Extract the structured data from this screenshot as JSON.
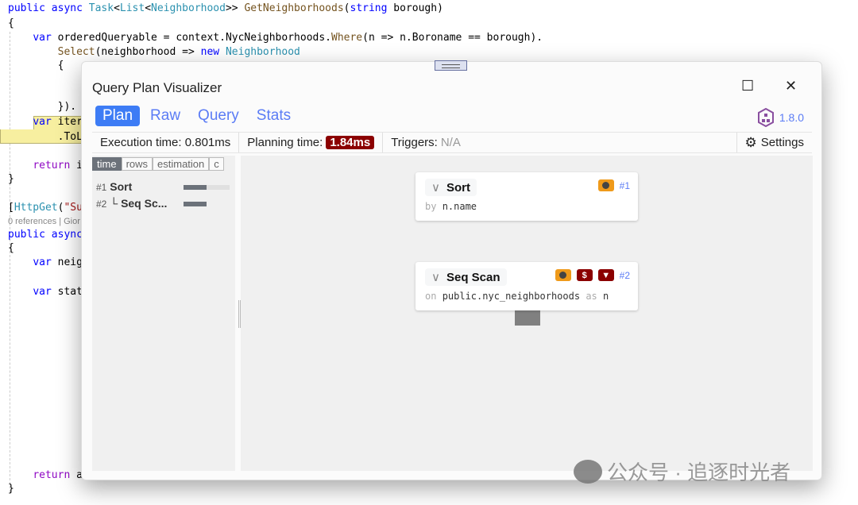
{
  "editor": {
    "lines": [
      {
        "parts": [
          [
            "kw",
            "public async "
          ],
          [
            "ty",
            "Task"
          ],
          [
            "",
            "<"
          ],
          [
            "ty",
            "List"
          ],
          [
            "",
            "<"
          ],
          [
            "ty",
            "Neighborhood"
          ],
          [
            "",
            ">> "
          ],
          [
            "fn",
            "GetNeighborhoods"
          ],
          [
            "",
            "("
          ],
          [
            "kw",
            "string"
          ],
          [
            "",
            " borough)"
          ]
        ]
      },
      {
        "parts": [
          [
            "",
            "{"
          ]
        ]
      },
      {
        "parts": [
          [
            "",
            "    "
          ],
          [
            "kw",
            "var"
          ],
          [
            "",
            " orderedQueryable = context.NycNeighborhoods."
          ],
          [
            "fn",
            "Where"
          ],
          [
            "",
            "(n => n.Boroname == borough)."
          ]
        ]
      },
      {
        "parts": [
          [
            "",
            "        "
          ],
          [
            "fn",
            "Select"
          ],
          [
            "",
            "(neighborhood => "
          ],
          [
            "kw",
            "new"
          ],
          [
            "",
            " "
          ],
          [
            "ty",
            "Neighborhood"
          ]
        ]
      },
      {
        "parts": [
          [
            "",
            "        {"
          ]
        ]
      },
      {
        "parts": [
          [
            "",
            "        })."
          ]
        ]
      },
      {
        "parts": [
          [
            "",
            "    "
          ],
          [
            "kw",
            "var"
          ],
          [
            "",
            " iter"
          ]
        ]
      },
      {
        "parts": [
          [
            "",
            "        .ToL"
          ]
        ]
      },
      {
        "parts": [
          [
            "",
            "    "
          ],
          [
            "ret",
            "return"
          ],
          [
            "",
            " i"
          ]
        ]
      },
      {
        "parts": [
          [
            "",
            "}"
          ]
        ]
      },
      {
        "parts": [
          [
            "",
            "["
          ],
          [
            "ty",
            "HttpGet"
          ],
          [
            "",
            "("
          ],
          [
            "str",
            "\"Su"
          ]
        ]
      },
      {
        "parts": [
          [
            "refs",
            "0 references | Gior"
          ]
        ]
      },
      {
        "parts": [
          [
            "kw",
            "public async"
          ]
        ]
      },
      {
        "parts": [
          [
            "",
            "{"
          ]
        ]
      },
      {
        "parts": [
          [
            "",
            "    "
          ],
          [
            "kw",
            "var"
          ],
          [
            "",
            " neig"
          ]
        ]
      },
      {
        "parts": [
          [
            "",
            "    "
          ],
          [
            "kw",
            "var"
          ],
          [
            "",
            " stat"
          ]
        ]
      },
      {
        "parts": [
          [
            "",
            "    "
          ],
          [
            "ret",
            "return"
          ],
          [
            "",
            " a"
          ]
        ]
      },
      {
        "parts": [
          [
            "",
            "}"
          ]
        ]
      }
    ]
  },
  "window": {
    "title": "Query Plan Visualizer",
    "maximize_icon": "☐",
    "close_icon": "✕"
  },
  "tabs": [
    {
      "label": "Plan",
      "active": true
    },
    {
      "label": "Raw"
    },
    {
      "label": "Query"
    },
    {
      "label": "Stats"
    }
  ],
  "version": "1.8.0",
  "info": {
    "execution_label": "Execution time:",
    "execution_value": "0.801ms",
    "planning_label": "Planning time:",
    "planning_value": "1.84ms",
    "triggers_label": "Triggers:",
    "triggers_value": "N/A",
    "settings_label": "Settings"
  },
  "metric_buttons": [
    "time",
    "rows",
    "estimation",
    "c"
  ],
  "nodes_list": [
    {
      "id": "#1",
      "name": "Sort",
      "prefix": "",
      "time_fraction": 0.5
    },
    {
      "id": "#2",
      "name": "Seq Sc...",
      "prefix": "└",
      "time_fraction": 0.5
    }
  ],
  "plan_nodes": [
    {
      "name": "Sort",
      "id": "#1",
      "sub_kw": "by",
      "sub_value": "n.name",
      "sub_kw2": "",
      "sub_value2": "",
      "icons": [
        "clock-icon"
      ]
    },
    {
      "name": "Seq Scan",
      "id": "#2",
      "sub_kw": "on",
      "sub_value": "public.nyc_neighborhoods",
      "sub_kw2": "as",
      "sub_value2": "n",
      "icons": [
        "clock-icon",
        "dollar-icon",
        "filter-icon"
      ]
    }
  ],
  "colors": {
    "accent": "#3d7cf5",
    "badge": "#8b0000",
    "clock": "#ef9a1a"
  },
  "watermark": "公众号 · 追逐时光者"
}
